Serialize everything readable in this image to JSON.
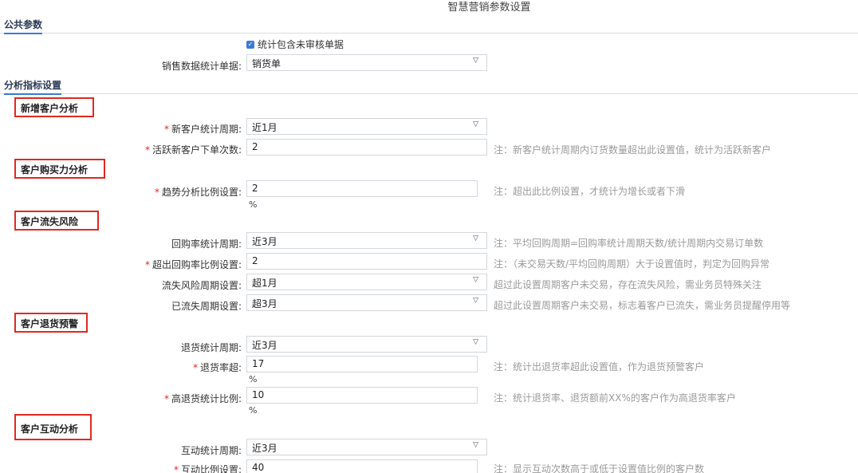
{
  "page_title": "智慧营销参数设置",
  "sections": {
    "public": "公共参数",
    "analysis": "分析指标设置"
  },
  "public": {
    "include_unapproved_label": "统计包含未审核单据",
    "sales_doc_label": "销售数据统计单据:",
    "sales_doc_value": "销货单"
  },
  "groups": {
    "new_customer": "新增客户分析",
    "purchase_power": "客户购买力分析",
    "churn_risk": "客户流失风险",
    "return_warning": "客户退货预警",
    "interaction": "客户互动分析"
  },
  "new_customer": {
    "period_label": "新客户统计周期:",
    "period_value": "近1月",
    "active_orders_label": "活跃新客户下单次数:",
    "active_orders_value": "2",
    "active_orders_note": "注：新客户统计周期内订货数量超出此设置值，统计为活跃新客户"
  },
  "purchase_power": {
    "trend_label": "趋势分析比例设置:",
    "trend_value": "2",
    "trend_unit": "%",
    "trend_note": "注：超出此比例设置，才统计为增长或者下滑"
  },
  "churn_risk": {
    "repurchase_period_label": "回购率统计周期:",
    "repurchase_period_value": "近3月",
    "repurchase_period_note": "注：平均回购周期=回购率统计周期天数/统计周期内交易订单数",
    "over_ratio_label": "超出回购率比例设置:",
    "over_ratio_value": "2",
    "over_ratio_note": "注：（未交易天数/平均回购周期）大于设置值时，判定为回购异常",
    "risk_period_label": "流失风险周期设置:",
    "risk_period_value": "超1月",
    "risk_period_note": "超过此设置周期客户未交易，存在流失风险，需业务员特殊关注",
    "lost_period_label": "已流失周期设置:",
    "lost_period_value": "超3月",
    "lost_period_note": "超过此设置周期客户未交易，标志着客户已流失，需业务员提醒停用等"
  },
  "return_warning": {
    "period_label": "退货统计周期:",
    "period_value": "近3月",
    "rate_label": "退货率超:",
    "rate_value": "17",
    "rate_unit": "%",
    "rate_note": "注：统计出退货率超此设置值，作为退货预警客户",
    "high_ratio_label": "高退货统计比例:",
    "high_ratio_value": "10",
    "high_ratio_unit": "%",
    "high_ratio_note": "注：统计退货率、退货额前XX%的客户作为高退货率客户"
  },
  "interaction": {
    "period_label": "互动统计周期:",
    "period_value": "近3月",
    "ratio_label": "互动比例设置:",
    "ratio_value": "40",
    "ratio_note": "注：显示互动次数高于或低于设置值比例的客户数"
  },
  "icons": {
    "caret": "chevron-down-icon",
    "check": "check-icon"
  },
  "colors": {
    "required": "#e0291f",
    "highlight_box": "#e0291f",
    "checkbox": "#3a7bd5"
  }
}
